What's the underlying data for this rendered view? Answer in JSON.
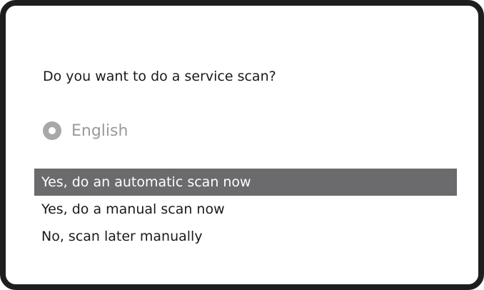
{
  "dialog": {
    "question": "Do you want to do a service scan?",
    "language_option": {
      "label": "English",
      "icon": "radio-button-icon"
    },
    "options": [
      {
        "label": "Yes, do an automatic scan now",
        "selected": true
      },
      {
        "label": "Yes, do a manual scan now",
        "selected": false
      },
      {
        "label": "No, scan later manually",
        "selected": false
      }
    ]
  },
  "colors": {
    "frame_border": "#1e1e1e",
    "highlight": "#6b6b6e",
    "disabled_text": "#9a9a9a"
  }
}
